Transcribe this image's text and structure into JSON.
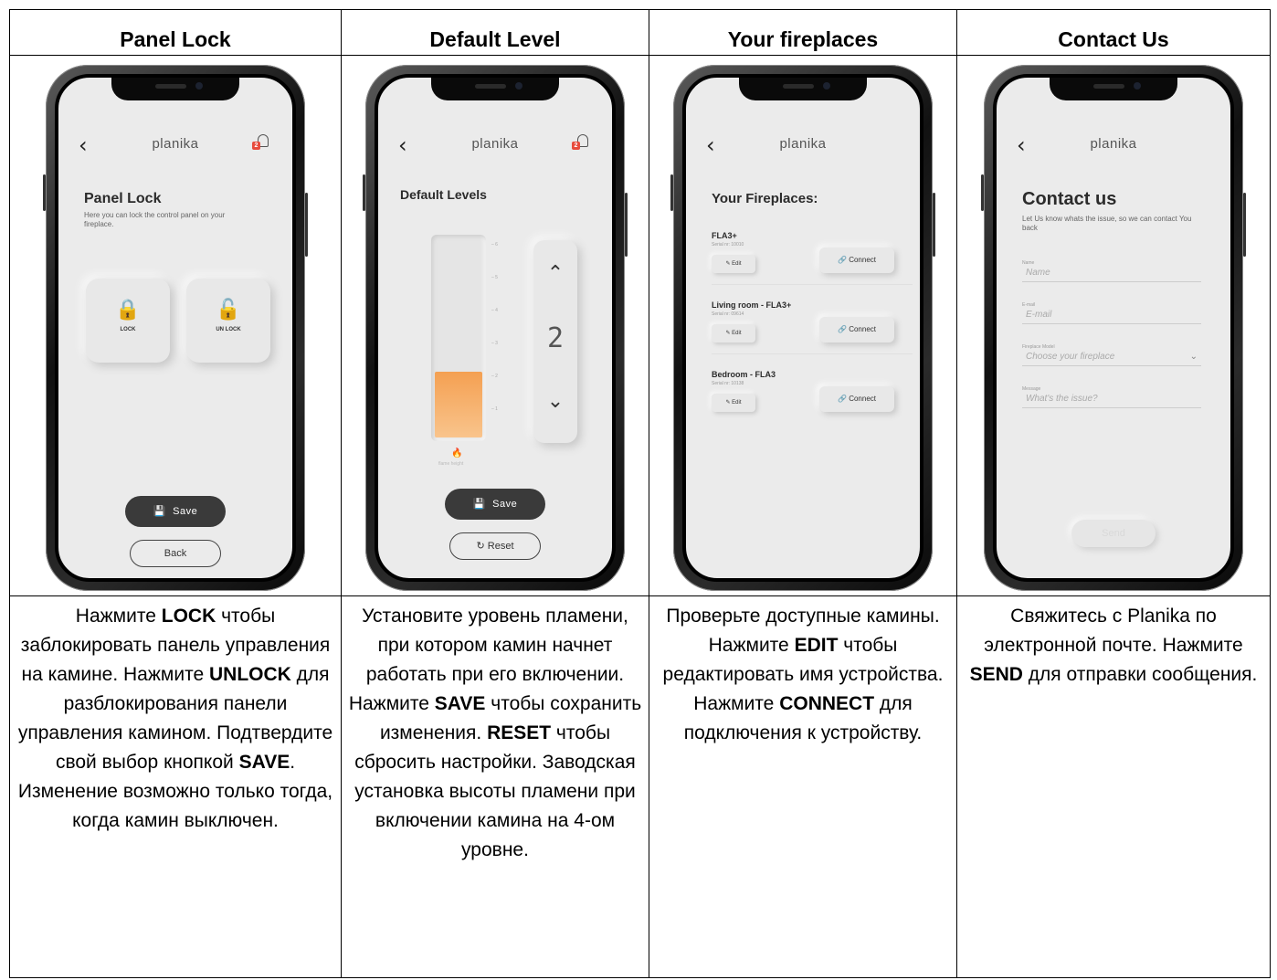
{
  "headers": [
    "Panel Lock",
    "Default Level",
    "Your fireplaces",
    "Contact Us"
  ],
  "app": {
    "brand": "planika",
    "badge": "2"
  },
  "panel_lock": {
    "title": "Panel Lock",
    "subtitle": "Here you can lock the control panel on your fireplace.",
    "lock_label": "LOCK",
    "unlock_label": "UN LOCK",
    "save_label": "Save",
    "back_label": "Back"
  },
  "default_level": {
    "title": "Default Levels",
    "ticks": [
      "6",
      "5",
      "4",
      "3",
      "2",
      "1"
    ],
    "level": 2,
    "max_level": 6,
    "display": "2",
    "flame_label": "flame height",
    "save_label": "Save",
    "reset_label": "Reset"
  },
  "fireplaces": {
    "title": "Your Fireplaces:",
    "items": [
      {
        "name": "FLA3+",
        "serial": "Serial nr: 10010",
        "edit": "Edit",
        "connect": "Connect"
      },
      {
        "name": "Living room - FLA3+",
        "serial": "Serial nr: 09614",
        "edit": "Edit",
        "connect": "Connect"
      },
      {
        "name": "Bedroom - FLA3",
        "serial": "Serial nr: 10138",
        "edit": "Edit",
        "connect": "Connect"
      }
    ]
  },
  "contact": {
    "title": "Contact us",
    "subtitle": "Let Us know whats the issue, so we can contact You back",
    "fields": [
      {
        "label": "Name",
        "placeholder": "Name"
      },
      {
        "label": "E-mail",
        "placeholder": "E-mail"
      },
      {
        "label": "Fireplace Model",
        "placeholder": "Choose your fireplace"
      },
      {
        "label": "Message",
        "placeholder": "What's the issue?"
      }
    ],
    "send_label": "Send"
  },
  "descriptions": {
    "panel_lock": [
      "Нажмите ",
      "LOCK",
      " чтобы заблокировать панель управления на камине. Нажмите ",
      "UNLOCK",
      " для разблокирования панели управления камином. Подтвердите свой выбор кнопкой ",
      "SAVE",
      ". Изменение возможно только тогда, когда камин выключен."
    ],
    "default_level": [
      "Установите уровень пламени, при котором камин начнет работать при его включении. Нажмите ",
      "SAVE",
      " чтобы сохранить изменения. ",
      "RESET",
      " чтобы сбросить настройки. Заводская установка высоты пламени при включении камина на 4-ом уровне."
    ],
    "fireplaces": [
      "Проверьте доступные камины. Нажмите ",
      "EDIT",
      " чтобы редактировать имя устройства. Нажмите ",
      "CONNECT",
      " для подключения к устройству."
    ],
    "contact": [
      "Свяжитесь с Planika по электронной почте. Нажмите ",
      "SEND",
      " для отправки сообщения."
    ]
  },
  "icons": {
    "back": "back-chevron-icon",
    "bell": "bell-icon",
    "lock": "lock-icon",
    "unlock": "unlock-icon",
    "save": "floppy-icon",
    "reset": "reset-icon",
    "edit": "edit-icon",
    "link": "link-icon",
    "up": "chevron-up-icon",
    "down": "chevron-down-icon",
    "flame": "flame-icon"
  },
  "colors": {
    "accent": "#f4a052",
    "badge": "#e74b3c",
    "dark_button": "#3a3a3a",
    "screen": "#ebebeb"
  }
}
